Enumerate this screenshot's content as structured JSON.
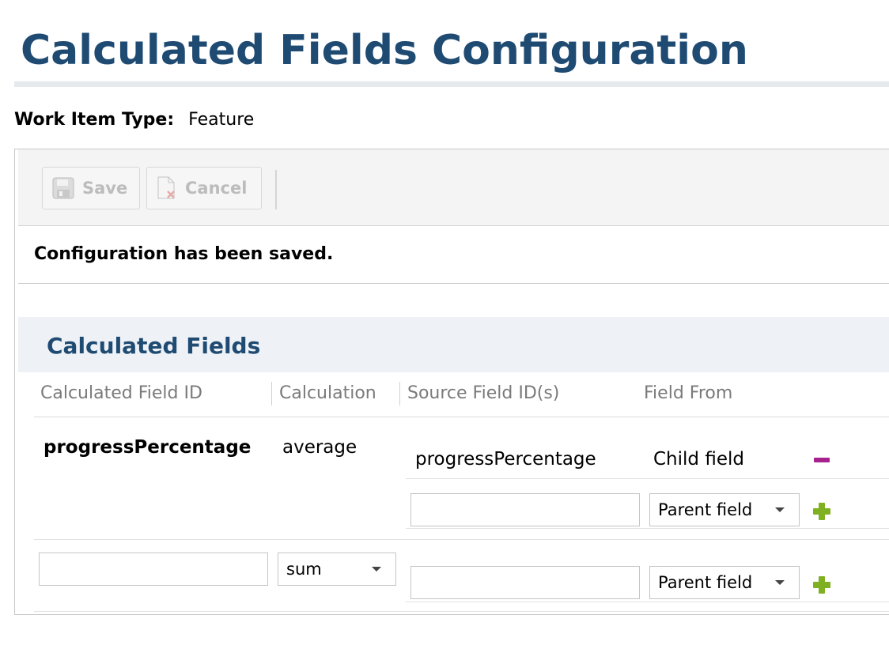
{
  "page": {
    "title": "Calculated Fields Configuration"
  },
  "work_item": {
    "label": "Work Item Type:",
    "value": "Feature"
  },
  "toolbar": {
    "save_label": "Save",
    "cancel_label": "Cancel"
  },
  "status": {
    "message": "Configuration has been saved."
  },
  "section": {
    "title": "Calculated Fields"
  },
  "columns": {
    "field_id": "Calculated Field ID",
    "calculation": "Calculation",
    "source": "Source Field ID(s)",
    "from": "Field From"
  },
  "rows": [
    {
      "field_id": "progressPercentage",
      "calculation": "average",
      "sources": [
        {
          "source_id": "progressPercentage",
          "field_from": "Child field"
        },
        {
          "source_placeholder": "",
          "field_from_select": "Parent field"
        }
      ]
    }
  ],
  "new_row": {
    "field_id_value": "",
    "calculation_select": "sum",
    "source_value": "",
    "field_from_select": "Parent field"
  },
  "colors": {
    "title": "#1f4b73",
    "remove": "#a7218f",
    "add": "#7fb022"
  },
  "icons": {
    "save": "floppy-disk-icon",
    "cancel": "document-x-icon",
    "remove": "minus-icon",
    "add": "plus-icon"
  }
}
